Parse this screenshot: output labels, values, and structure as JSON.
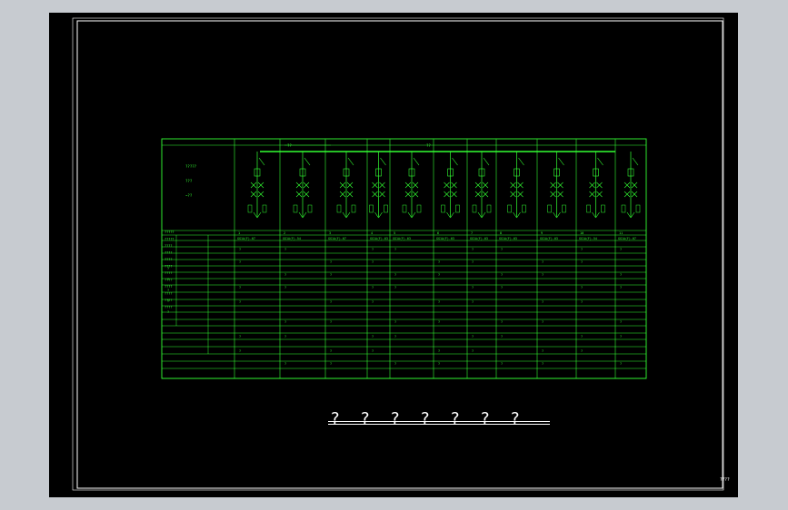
{
  "colors": {
    "background": "#000000",
    "desktop": "#c7cbd0",
    "line": "#33ff33",
    "frame": "#ffffff",
    "title": "#ffffff"
  },
  "title_chars": [
    "?",
    "?",
    "?",
    "?",
    "?",
    "?",
    "?"
  ],
  "drawing_no": "????",
  "left_panel": [
    "?????",
    "???",
    "~??"
  ],
  "busbars": [
    {
      "label": "??"
    },
    {
      "label": "??"
    }
  ],
  "panels": [
    {
      "no": "1",
      "type": "GG1A(F)-07",
      "circuit": "?",
      "device": "?"
    },
    {
      "no": "2",
      "type": "GG1A(F)-54",
      "circuit": "?",
      "device": "?"
    },
    {
      "no": "3",
      "type": "GG1A(F)-07",
      "circuit": "?",
      "device": "?"
    },
    {
      "no": "4",
      "type": "GG1A(F)-03",
      "circuit": "?",
      "device": "?"
    },
    {
      "no": "5",
      "type": "GG1A(F)-03",
      "circuit": "?",
      "device": "?"
    },
    {
      "no": "6",
      "type": "GG1A(F)-03",
      "circuit": "?",
      "device": "?"
    },
    {
      "no": "7",
      "type": "GG1A(F)-03",
      "circuit": "?",
      "device": "?"
    },
    {
      "no": "8",
      "type": "GG1A(F)-03",
      "circuit": "?",
      "device": "?"
    },
    {
      "no": "9",
      "type": "GG1A(F)-03",
      "circuit": "?",
      "device": "?"
    },
    {
      "no": "10",
      "type": "GG1A(F)-54",
      "circuit": "?",
      "device": "?"
    },
    {
      "no": "11",
      "type": "GG1A(F)-07",
      "circuit": "?",
      "device": "?"
    }
  ],
  "row_labels": [
    "?????",
    "?????",
    "????",
    "????",
    "????",
    "????",
    "????",
    "????",
    "????",
    "????",
    "????",
    "????"
  ],
  "side_marks": [
    "?",
    "?",
    "?",
    "?",
    "?"
  ],
  "table_cells": [
    "?",
    "?",
    "?",
    "?",
    "?",
    "?",
    "?",
    "?",
    "?",
    "?",
    "?",
    "?"
  ]
}
